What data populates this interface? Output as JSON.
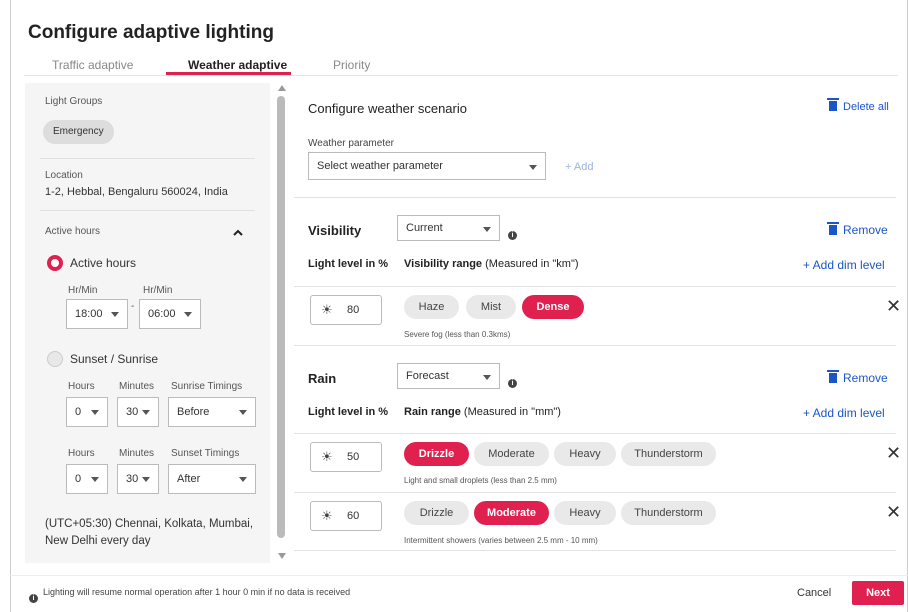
{
  "title": "Configure adaptive lighting",
  "tabs": [
    "Traffic adaptive",
    "Weather adaptive",
    "Priority"
  ],
  "left": {
    "light_groups_label": "Light Groups",
    "light_group_chip": "Emergency",
    "location_label": "Location",
    "location_value": "1-2, Hebbal, Bengaluru 560024, India",
    "active_hours_header": "Active hours",
    "active_hours_option": "Active hours",
    "hrmin_label": "Hr/Min",
    "start_time": "18:00",
    "end_time": "06:00",
    "dash": "-",
    "sunset_sunrise_option": "Sunset / Sunrise",
    "hours_label": "Hours",
    "minutes_label": "Minutes",
    "sunrise_timings_label": "Sunrise Timings",
    "sunset_timings_label": "Sunset Timings",
    "sunrise": {
      "hours": "0",
      "minutes": "30",
      "timing": "Before"
    },
    "sunset": {
      "hours": "0",
      "minutes": "30",
      "timing": "After"
    },
    "timezone": "(UTC+05:30) Chennai, Kolkata, Mumbai, New Delhi every day"
  },
  "right": {
    "section_title": "Configure weather scenario",
    "delete_all": "Delete all",
    "weather_param_label": "Weather parameter",
    "weather_param_placeholder": "Select weather parameter",
    "add": "+  Add",
    "light_level_label": "Light level in %",
    "remove": "Remove",
    "add_dim_level": "+  Add dim level",
    "visibility": {
      "name": "Visibility",
      "mode": "Current",
      "range_label": "Visibility range",
      "range_unit": "(Measured in \"km\")",
      "rows": [
        {
          "level": "80",
          "options": [
            "Haze",
            "Mist",
            "Dense"
          ],
          "selected": 2,
          "hint": "Severe fog (less than 0.3kms)"
        }
      ]
    },
    "rain": {
      "name": "Rain",
      "mode": "Forecast",
      "range_label": "Rain range",
      "range_unit": "(Measured in \"mm\")",
      "rows": [
        {
          "level": "50",
          "options": [
            "Drizzle",
            "Moderate",
            "Heavy",
            "Thunderstorm"
          ],
          "selected": 0,
          "hint": "Light and small droplets (less than 2.5 mm)"
        },
        {
          "level": "60",
          "options": [
            "Drizzle",
            "Moderate",
            "Heavy",
            "Thunderstorm"
          ],
          "selected": 1,
          "hint": "Intermittent showers (varies between 2.5 mm - 10 mm)"
        }
      ]
    }
  },
  "footer": {
    "notice": "Lighting will resume normal operation after 1 hour 0 min if no data is received",
    "cancel": "Cancel",
    "next": "Next"
  },
  "colors": {
    "accent": "#e0204f",
    "link": "#1a56c8"
  }
}
